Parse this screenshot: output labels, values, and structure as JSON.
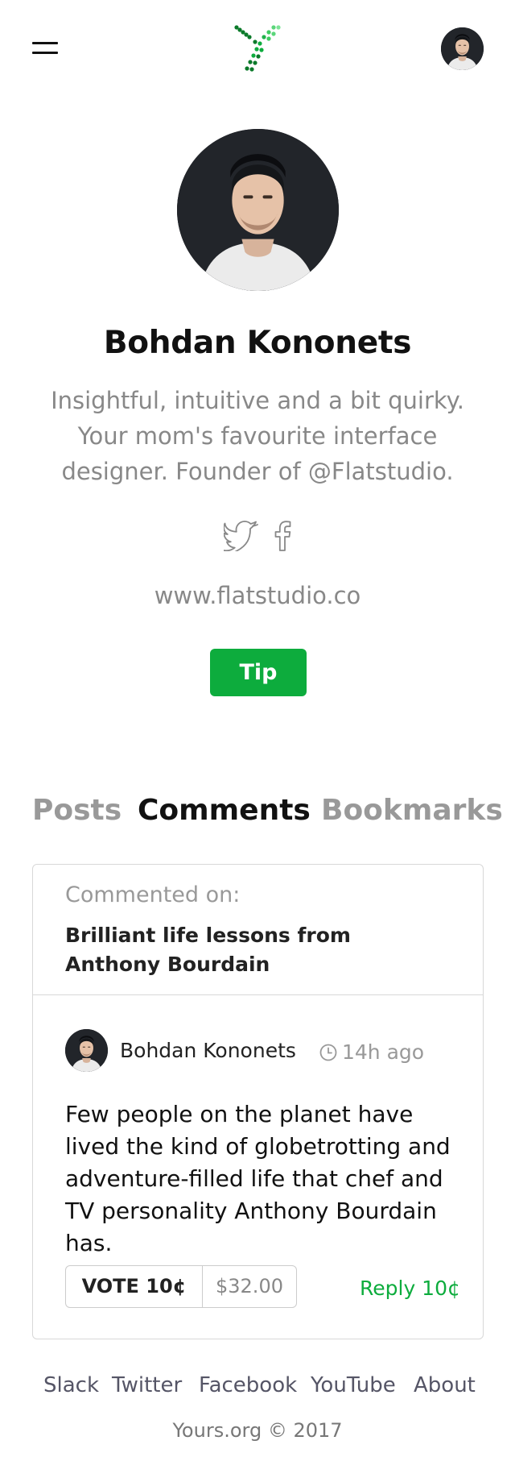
{
  "header": {
    "menu_icon": "hamburger-icon",
    "logo_icon": "dots-y-logo",
    "accent_color": "#0dac3d"
  },
  "profile": {
    "name": "Bohdan Kononets",
    "bio": "Insightful, intuitive and a bit quirky. Your mom's favourite interface designer. Founder of @Flatstudio.",
    "social_icons": [
      "twitter-icon",
      "facebook-icon"
    ],
    "website": "www.flatstudio.co",
    "tip_label": "Tip"
  },
  "tabs": [
    {
      "label": "Posts",
      "active": false
    },
    {
      "label": "Comments",
      "active": true
    },
    {
      "label": "Bookmarks",
      "active": false
    }
  ],
  "comment": {
    "commented_on_label": "Commented on:",
    "post_title": "Brilliant life lessons from Anthony Bourdain",
    "author": "Bohdan Kononets",
    "time": "14h ago",
    "body": "Few people on the planet have lived the kind of globetrotting and adventure-filled life that chef and TV personality Anthony Bourdain has.",
    "vote_label": "VOTE 10¢",
    "vote_total": "$32.00",
    "reply_label": "Reply 10¢"
  },
  "footer": {
    "links": [
      "Slack",
      "Twitter",
      "Facebook",
      "YouTube",
      "About"
    ],
    "copyright": "Yours.org © 2017"
  }
}
